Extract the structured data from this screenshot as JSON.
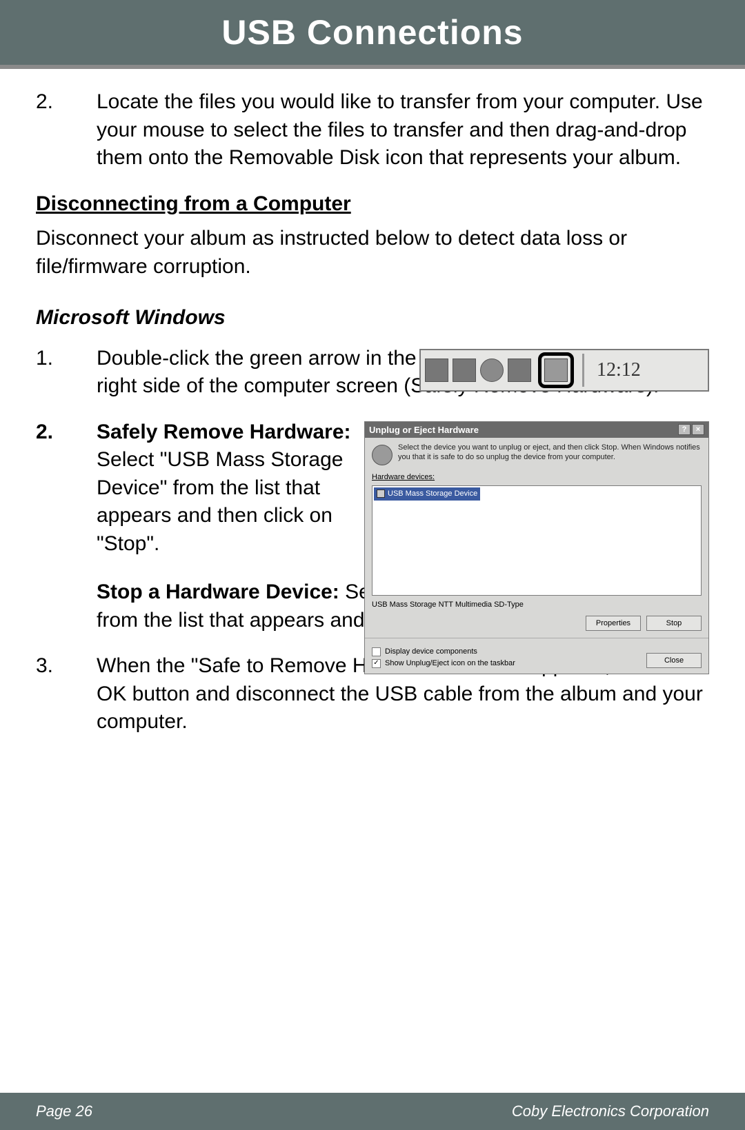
{
  "header": {
    "title": "USB Connections"
  },
  "intro_step": {
    "num": "2.",
    "text": "Locate the files you would like to transfer from your computer. Use your mouse to select the files to transfer and then drag-and-drop them onto the Removable Disk icon that represents your album."
  },
  "section1": {
    "heading": "Disconnecting from a Computer",
    "para": "Disconnect your album as instructed below to detect data loss or file/firmware corruption."
  },
  "section2": {
    "heading": "Microsoft Windows"
  },
  "win_step1": {
    "num": "1.",
    "text": "Double-click the green arrow in the taskbar located on the lower-right side of the computer screen (Safely Remove Hardware)."
  },
  "taskbar": {
    "time": "12:12"
  },
  "win_step2": {
    "num": "2.",
    "label": "Safely Remove Hardware: ",
    "text": "Select \"USB Mass Storage Device\" from the list that appears and then click on \"Stop\".",
    "label2": "Stop a Hardware Device: ",
    "text2": "Select \"USB Mass Storage Device\" from the list that appears and then click on \"OK\"."
  },
  "dialog": {
    "title": "Unplug or Eject Hardware",
    "instr": "Select the device you want to unplug or eject, and then click Stop. When Windows notifies you that it is safe to do so unplug the device from your computer.",
    "list_label": "Hardware devices:",
    "item": "USB Mass Storage Device",
    "desc": "USB Mass Storage NTT Multimedia SD-Type",
    "btn_properties": "Properties",
    "btn_stop": "Stop",
    "cb1": "Display device components",
    "cb2": "Show Unplug/Eject icon on the taskbar",
    "btn_close": "Close"
  },
  "win_step3": {
    "num": "3.",
    "text": "When the \"Safe to Remove Hardware\" window appears, click the OK button and disconnect the USB cable from the album and your computer."
  },
  "footer": {
    "page": "Page 26",
    "company": "Coby Electronics Corporation"
  }
}
